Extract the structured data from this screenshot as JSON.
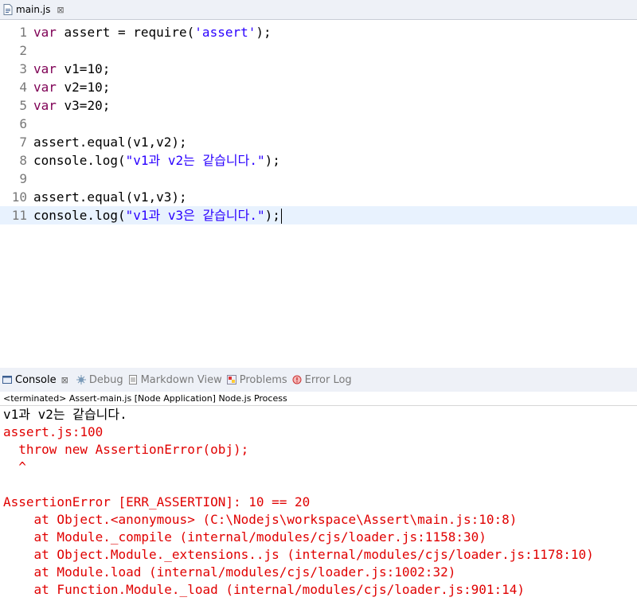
{
  "editor": {
    "tab_label": "main.js",
    "tab_close": "⊠",
    "lines": [
      {
        "num": "1",
        "parts": [
          {
            "t": "var",
            "c": "kw"
          },
          {
            "t": " assert = require(",
            "c": ""
          },
          {
            "t": "'assert'",
            "c": "str"
          },
          {
            "t": ");",
            "c": ""
          }
        ]
      },
      {
        "num": "2",
        "parts": []
      },
      {
        "num": "3",
        "parts": [
          {
            "t": "var",
            "c": "kw"
          },
          {
            "t": " v1=10;",
            "c": ""
          }
        ]
      },
      {
        "num": "4",
        "parts": [
          {
            "t": "var",
            "c": "kw"
          },
          {
            "t": " v2=10;",
            "c": ""
          }
        ]
      },
      {
        "num": "5",
        "parts": [
          {
            "t": "var",
            "c": "kw"
          },
          {
            "t": " v3=20;",
            "c": ""
          }
        ]
      },
      {
        "num": "6",
        "parts": []
      },
      {
        "num": "7",
        "parts": [
          {
            "t": "assert.equal(v1,v2);",
            "c": ""
          }
        ]
      },
      {
        "num": "8",
        "parts": [
          {
            "t": "console.log(",
            "c": ""
          },
          {
            "t": "\"v1과 v2는 같습니다.\"",
            "c": "str"
          },
          {
            "t": ");",
            "c": ""
          }
        ]
      },
      {
        "num": "9",
        "parts": []
      },
      {
        "num": "10",
        "parts": [
          {
            "t": "assert.equal(v1,v3);",
            "c": ""
          }
        ]
      },
      {
        "num": "11",
        "parts": [
          {
            "t": "console.log(",
            "c": ""
          },
          {
            "t": "\"v1과 v3은 같습니다.\"",
            "c": "str"
          },
          {
            "t": ");",
            "c": ""
          }
        ],
        "current": true
      }
    ],
    "scroll_left_arrow": "<"
  },
  "console_tabs": [
    {
      "label": "Console",
      "icon": "console-icon",
      "active": true,
      "close": "⊠"
    },
    {
      "label": "Debug",
      "icon": "debug-icon",
      "active": false
    },
    {
      "label": "Markdown View",
      "icon": "markdown-icon",
      "active": false
    },
    {
      "label": "Problems",
      "icon": "problems-icon",
      "active": false
    },
    {
      "label": "Error Log",
      "icon": "error-log-icon",
      "active": false
    }
  ],
  "console": {
    "status": "<terminated> Assert-main.js [Node Application] Node.js Process",
    "output": [
      {
        "text": "v1과 v2는 같습니다.",
        "kind": "stdout"
      },
      {
        "text": "assert.js:100",
        "kind": "stderr"
      },
      {
        "text": "  throw new AssertionError(obj);",
        "kind": "stderr"
      },
      {
        "text": "  ^",
        "kind": "stderr"
      },
      {
        "text": "",
        "kind": "stderr"
      },
      {
        "text": "AssertionError [ERR_ASSERTION]: 10 == 20",
        "kind": "stderr"
      },
      {
        "text": "    at Object.<anonymous> (C:\\Nodejs\\workspace\\Assert\\main.js:10:8)",
        "kind": "stderr"
      },
      {
        "text": "    at Module._compile (internal/modules/cjs/loader.js:1158:30)",
        "kind": "stderr"
      },
      {
        "text": "    at Object.Module._extensions..js (internal/modules/cjs/loader.js:1178:10)",
        "kind": "stderr"
      },
      {
        "text": "    at Module.load (internal/modules/cjs/loader.js:1002:32)",
        "kind": "stderr"
      },
      {
        "text": "    at Function.Module._load (internal/modules/cjs/loader.js:901:14)",
        "kind": "stderr"
      }
    ]
  },
  "colors": {
    "keyword": "#7f0055",
    "string": "#2a00ff",
    "stderr": "#e00000",
    "current_line": "#e8f2fe"
  }
}
